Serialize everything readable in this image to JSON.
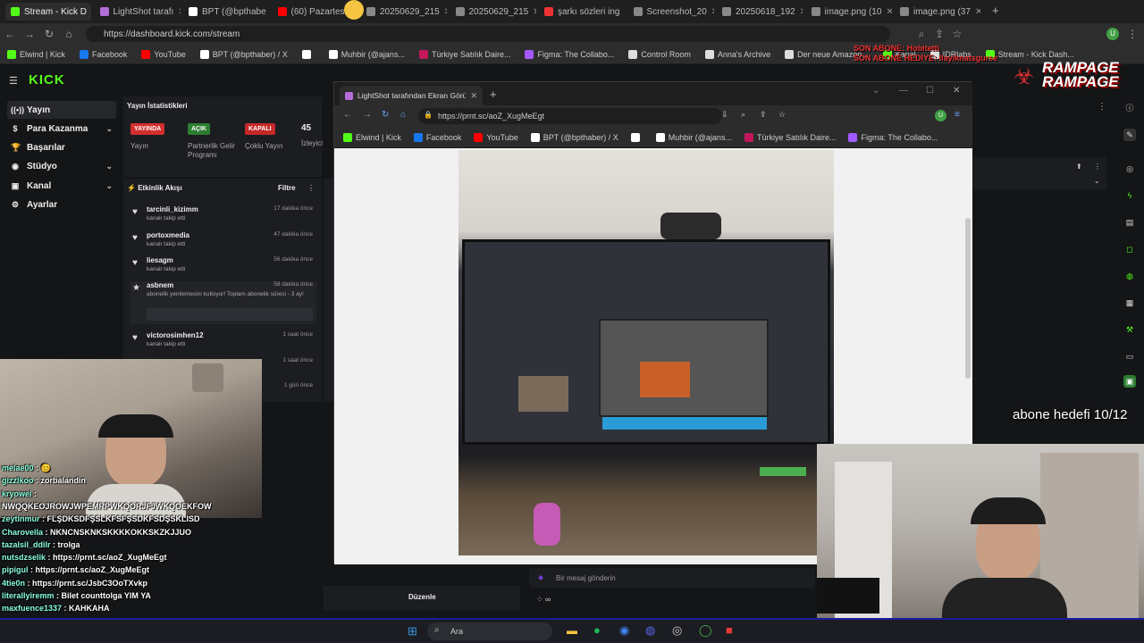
{
  "browser": {
    "tabs": [
      {
        "label": "Stream - Kick D",
        "color": "#53fc18",
        "active": true
      },
      {
        "label": "LightShot tarafı",
        "color": "#b26dd8",
        "active": false
      },
      {
        "label": "BPT (@bpthabe",
        "color": "#ffffff",
        "active": false
      },
      {
        "label": "(60) Pazartesi",
        "color": "#ff0000",
        "active": false
      },
      {
        "label": "20250629_215",
        "color": "#888888",
        "active": false
      },
      {
        "label": "20250629_215",
        "color": "#888888",
        "active": false
      },
      {
        "label": "şarkı sözleri ing",
        "color": "#e33",
        "active": false
      },
      {
        "label": "Screenshot_20",
        "color": "#888888",
        "active": false
      },
      {
        "label": "20250618_192",
        "color": "#888888",
        "active": false
      },
      {
        "label": "image.png (10",
        "color": "#888888",
        "active": false
      },
      {
        "label": "image.png (37",
        "color": "#888888",
        "active": false
      }
    ],
    "url": "https://dashboard.kick.com/stream",
    "bookmarks": [
      {
        "label": "Elwind | Kick",
        "color": "#53fc18"
      },
      {
        "label": "Facebook",
        "color": "#1877f2"
      },
      {
        "label": "YouTube",
        "color": "#ff0000"
      },
      {
        "label": "BPT (@bpthaber) / X",
        "color": "#ffffff"
      },
      {
        "label": "",
        "color": "#ffffff"
      },
      {
        "label": "Muhbir (@ajans...",
        "color": "#ffffff"
      },
      {
        "label": "Türkiye Satılık Daire...",
        "color": "#c2185b"
      },
      {
        "label": "Figma: The Collabo...",
        "color": "#a259ff"
      },
      {
        "label": "Control Room",
        "color": "#dddddd"
      },
      {
        "label": "Anna's Archive",
        "color": "#dddddd"
      },
      {
        "label": "Der neue Amazon...",
        "color": "#dddddd"
      },
      {
        "label": "Kanal",
        "color": "#53fc18"
      },
      {
        "label": "IDRlabs",
        "color": "#dddddd"
      },
      {
        "label": "Stream - Kick Dash...",
        "color": "#53fc18"
      }
    ]
  },
  "kick": {
    "logo": "KICK",
    "sidebar": [
      {
        "label": "Yayın",
        "icon": "broadcast-icon",
        "glyph": "((•))",
        "chevron": false,
        "active": true
      },
      {
        "label": "Para Kazanma",
        "icon": "money-icon",
        "glyph": "$",
        "chevron": true,
        "active": false
      },
      {
        "label": "Başarılar",
        "icon": "trophy-icon",
        "glyph": "🏆",
        "chevron": false,
        "active": false
      },
      {
        "label": "Stüdyo",
        "icon": "studio-icon",
        "glyph": "◉",
        "chevron": true,
        "active": false
      },
      {
        "label": "Kanal",
        "icon": "channel-icon",
        "glyph": "▣",
        "chevron": true,
        "active": false
      },
      {
        "label": "Ayarlar",
        "icon": "settings-icon",
        "glyph": "⚙",
        "chevron": false,
        "active": false
      }
    ],
    "stats": {
      "title": "Yayın İstatistikleri",
      "items": [
        {
          "badge": "YAYINDA",
          "badge_color": "#d32f2f",
          "label": "Yayın"
        },
        {
          "badge": "AÇIK",
          "badge_color": "#2e7d32",
          "label": "Partnerlik Gelir Programı"
        },
        {
          "badge": "KAPALI",
          "badge_color": "#c62828",
          "label": "Çoklu Yayın"
        }
      ],
      "viewers_value": "45",
      "viewers_label": "İzleyici"
    },
    "activity": {
      "title": "Etkinlik Akışı",
      "filter": "Filtre",
      "events": [
        {
          "name": "tarcinli_kizimm",
          "sub": "kanalı takip etti",
          "time": "17 dakika önce"
        },
        {
          "name": "portoxmedia",
          "sub": "kanalı takip etti",
          "time": "47 dakika önce"
        },
        {
          "name": "liesagm",
          "sub": "kanalı takip etti",
          "time": "56 dakika önce"
        },
        {
          "name": "asbnem",
          "sub": "abonelik yenilemesini kutluyor! Toplam abonelik süresi - 3 ay!",
          "time": "58 dakika önce"
        },
        {
          "name": "victorosimhen12",
          "sub": "kanalı takip etti",
          "time": "1 saat önce"
        },
        {
          "name": "",
          "sub": "",
          "time": "1 saat önce"
        },
        {
          "name": "",
          "sub": "",
          "time": "1 gün önce"
        }
      ]
    },
    "edit_button": "Düzenle",
    "chat_placeholder": "Bir mesaj gönderin"
  },
  "lightshot": {
    "tab_title": "LightShot tarafından Ekran Görü",
    "url": "https://prnt.sc/aoZ_XugMeEgt",
    "bookmarks": [
      {
        "label": "Elwind | Kick",
        "color": "#53fc18"
      },
      {
        "label": "Facebook",
        "color": "#1877f2"
      },
      {
        "label": "YouTube",
        "color": "#ff0000"
      },
      {
        "label": "BPT (@bpthaber) / X",
        "color": "#ffffff"
      },
      {
        "label": "",
        "color": "#ffffff"
      },
      {
        "label": "Muhbir (@ajans...",
        "color": "#ffffff"
      },
      {
        "label": "Türkiye Satılık Daire...",
        "color": "#c2185b"
      },
      {
        "label": "Figma: The Collabo...",
        "color": "#a259ff"
      }
    ]
  },
  "overlay": {
    "goal_text": "abone hedefi 10/12",
    "brand_line1": "RAMPAGE",
    "brand_line2": "RAMPAGE",
    "red_line1": "SON ABONE: Hobitetti",
    "red_line2": "SON ABONE HEDİYE: ilayiknatsgurse"
  },
  "chat_overlay": [
    {
      "user": "melae00",
      "msg": "😊"
    },
    {
      "user": "gizzlkoo",
      "msg": "zorbalandin"
    },
    {
      "user": "kryowei",
      "msg": ""
    },
    {
      "user": "",
      "msg": "NWQQKEOJROWJWPEMRPWKQORJFJWKQOEKFOW"
    },
    {
      "user": "zeytinmur",
      "msg": "FLŞDKSDFŞSLKFSFŞSDKFSDŞSKLISD"
    },
    {
      "user": "Charovella",
      "msg": "NKNCNSKNKSKKKKOKKSKZKJJUO"
    },
    {
      "user": "tazalsil_ddilr",
      "msg": "trolga"
    },
    {
      "user": "nutsdzselik",
      "msg": "https://prnt.sc/aoZ_XugMeEgt"
    },
    {
      "user": "pipigul",
      "msg": "https://prnt.sc/aoZ_XugMeEgt"
    },
    {
      "user": "4tie0n",
      "msg": "https://prnt.sc/JsbC3OoTXvkp"
    },
    {
      "user": "literallyiremm",
      "msg": "Bilet counttolga YIM YA"
    },
    {
      "user": "maxfuence1337",
      "msg": "KAHKAHA"
    }
  ],
  "taskbar": {
    "search": "Ara"
  }
}
